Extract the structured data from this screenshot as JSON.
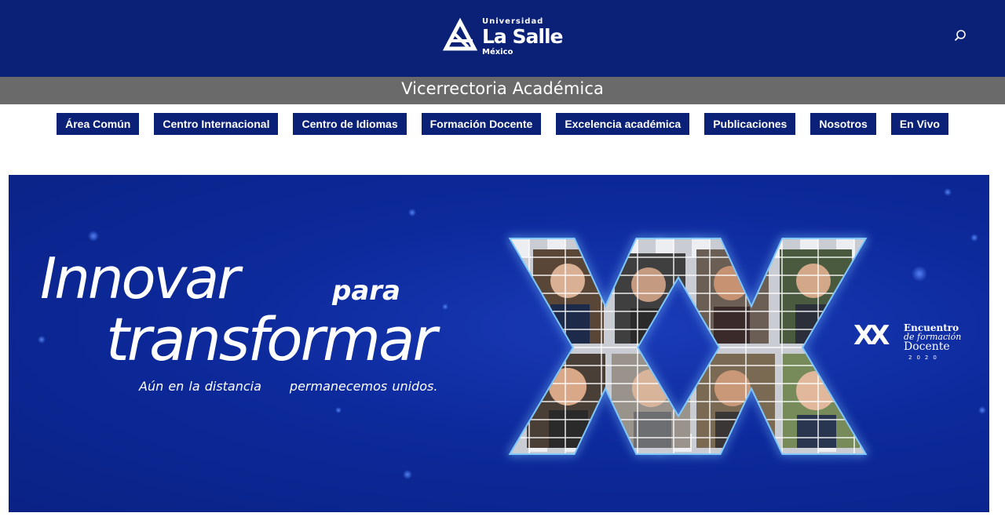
{
  "header": {
    "logo": {
      "top_text": "Universidad",
      "name": "La Salle",
      "registered": "®",
      "country": "México"
    },
    "search_icon": "search-icon"
  },
  "subheader": {
    "title": "Vicerrectoria Académica"
  },
  "nav": {
    "items": [
      {
        "label": "Área Común"
      },
      {
        "label": "Centro Internacional"
      },
      {
        "label": "Centro de Idiomas"
      },
      {
        "label": "Formación Docente"
      },
      {
        "label": "Excelencia académica"
      },
      {
        "label": "Publicaciones"
      },
      {
        "label": "Nosotros"
      },
      {
        "label": "En Vivo"
      }
    ]
  },
  "banner": {
    "headline_line1": "Innovar",
    "headline_para": "para",
    "headline_line2": "transformar",
    "tagline_part1": "Aún en la distancia",
    "tagline_part2": "permanecemos unidos.",
    "badge": {
      "numeral": "XX",
      "line1": "Encuentro",
      "line2": "de formación",
      "line3": "Docente",
      "year": "2020"
    }
  },
  "colors": {
    "brand_blue": "#0a2177",
    "subbar_grey": "#6a6a6a",
    "banner_blue": "#0d2a9c"
  }
}
